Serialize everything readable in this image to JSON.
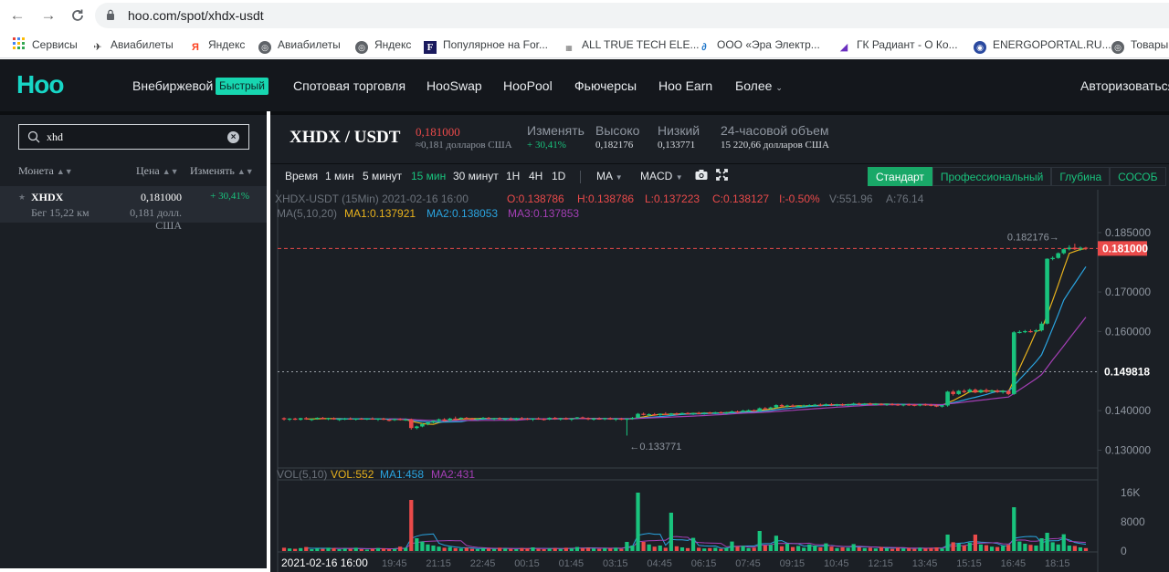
{
  "browser": {
    "url": "hoo.com/spot/xhdx-usdt",
    "bookmarks": [
      {
        "label": "Сервисы",
        "icon": "apps-grid-icon"
      },
      {
        "label": "Авиабилеты",
        "icon": "plane-icon"
      },
      {
        "label": "Яндекс",
        "icon": "yandex-icon"
      },
      {
        "label": "Авиабилеты",
        "icon": "globe-icon"
      },
      {
        "label": "Яндекс",
        "icon": "globe-icon"
      },
      {
        "label": "Популярное на For...",
        "icon": "forbes-icon"
      },
      {
        "label": "ALL TRUE TECH ELE...",
        "icon": "site-icon"
      },
      {
        "label": "ООО «Эра Электр...",
        "icon": "era-icon"
      },
      {
        "label": "ГК Радиант - О Ко...",
        "icon": "radiant-icon"
      },
      {
        "label": "ENERGOPORTAL.RU...",
        "icon": "energoportal-icon"
      },
      {
        "label": "Товары",
        "icon": "globe-icon"
      }
    ]
  },
  "header": {
    "logo": "Hoo",
    "nav": {
      "otc": "Внебиржевой",
      "otc_badge": "Быстрый",
      "spot": "Спотовая торговля",
      "swap": "HooSwap",
      "pool": "HooPool",
      "futures": "Фьючерсы",
      "earn": "Hoo Earn",
      "more": "Более",
      "login": "Авторизоваться"
    }
  },
  "market": {
    "search_value": "xhd",
    "columns": {
      "coin": "Монета",
      "price": "Цена",
      "change": "Изменять"
    },
    "rows": [
      {
        "symbol": "XHDX",
        "volume": "Бег 15,22 км",
        "price": "0,181000",
        "price_usd": "0,181 долл. США",
        "change": "+ 30,41%"
      }
    ]
  },
  "ticker": {
    "pair": "XHDX / USDT",
    "last_price": "0,181000",
    "last_price_usd": "≈0,181 долларов США",
    "change_label": "Изменять",
    "change_value": "+ 30,41%",
    "high_label": "Высоко",
    "high_value": "0,182176",
    "low_label": "Низкий",
    "low_value": "0,133771",
    "volume_label": "24-часовой объем",
    "volume_value": "15 220,66 долларов США"
  },
  "toolbar": {
    "time_label": "Время",
    "intervals": [
      "1 мин",
      "5 минут",
      "15 мин",
      "30 минут",
      "1H",
      "4H",
      "1D"
    ],
    "active_interval": "15 мин",
    "indicator1": "MA",
    "indicator2": "MACD",
    "views": [
      "Стандарт",
      "Профессиональный",
      "Глубина",
      "СОСОБ"
    ],
    "active_view": "Стандарт"
  },
  "chart_info": {
    "symbol_line": "XHDX-USDT (15Min) 2021-02-16 16:00",
    "o": "O:0.138786",
    "h": "H:0.138786",
    "l": "L:0.137223",
    "c": "C:0.138127",
    "i": "I:-0.50%",
    "v": "V:551.96",
    "a": "A:76.14",
    "ma_params": "MA(5,10,20)",
    "ma1": "MA1:0.137921",
    "ma2": "MA2:0.138053",
    "ma3": "MA3:0.137853",
    "vol_params": "VOL(5,10)",
    "vol": "VOL:552",
    "vol_ma1": "MA1:458",
    "vol_ma2": "MA2:431",
    "high_marker": "0.182176→",
    "low_marker": "←0.133771",
    "current_price_tag": "0.181000",
    "crosshair_price_tag": "0.149818",
    "first_time_label": "2021-02-16  16:00"
  },
  "colors": {
    "up": "#19c37d",
    "down": "#ea4a4a",
    "ma1": "#e8b21d",
    "ma2": "#2aa4e0",
    "ma3": "#a43fb5",
    "accent": "#17d6c6"
  },
  "chart_data": {
    "type": "candlestick",
    "price_axis_ticks": [
      0.185,
      0.17,
      0.16,
      0.14,
      0.13
    ],
    "price_axis_labels": [
      "0.185000",
      "0.170000",
      "0.160000",
      "0.140000",
      "0.130000"
    ],
    "price_range": [
      0.1255,
      0.188
    ],
    "volume_axis_labels": [
      "16K",
      "8000",
      "0"
    ],
    "volume_axis_ticks": [
      16000,
      8000,
      0
    ],
    "volume_max": 19000,
    "time_labels": [
      "19:45",
      "21:15",
      "22:45",
      "00:15",
      "01:45",
      "03:15",
      "04:45",
      "06:15",
      "07:45",
      "09:15",
      "10:45",
      "12:15",
      "13:45",
      "15:15",
      "16:45",
      "18:15"
    ],
    "high": 0.182176,
    "low": 0.133771,
    "last": 0.181,
    "crosshair": 0.149818,
    "candles": [
      [
        0.1381,
        0.1383,
        0.1375,
        0.1378,
        900
      ],
      [
        0.1378,
        0.1381,
        0.1374,
        0.138,
        700
      ],
      [
        0.138,
        0.1382,
        0.1376,
        0.1377,
        600
      ],
      [
        0.1377,
        0.1382,
        0.1375,
        0.1381,
        800
      ],
      [
        0.1381,
        0.1384,
        0.1377,
        0.1378,
        1100
      ],
      [
        0.1378,
        0.138,
        0.1374,
        0.1379,
        500
      ],
      [
        0.1379,
        0.1383,
        0.1377,
        0.1382,
        700
      ],
      [
        0.1382,
        0.1384,
        0.1378,
        0.1379,
        600
      ],
      [
        0.1379,
        0.1382,
        0.1376,
        0.1381,
        900
      ],
      [
        0.1381,
        0.1383,
        0.1377,
        0.1378,
        800
      ],
      [
        0.1378,
        0.138,
        0.1374,
        0.1379,
        500
      ],
      [
        0.1379,
        0.1382,
        0.1376,
        0.138,
        700
      ],
      [
        0.138,
        0.1383,
        0.1377,
        0.1378,
        600
      ],
      [
        0.1378,
        0.1381,
        0.1375,
        0.138,
        900
      ],
      [
        0.138,
        0.1382,
        0.1377,
        0.1379,
        500
      ],
      [
        0.1379,
        0.1381,
        0.1376,
        0.138,
        400
      ],
      [
        0.138,
        0.1383,
        0.1377,
        0.1378,
        600
      ],
      [
        0.1378,
        0.1381,
        0.1374,
        0.138,
        800
      ],
      [
        0.138,
        0.1382,
        0.1376,
        0.1377,
        700
      ],
      [
        0.1377,
        0.1379,
        0.1373,
        0.1376,
        500
      ],
      [
        0.1376,
        0.138,
        0.1374,
        0.1379,
        600
      ],
      [
        0.1379,
        0.1381,
        0.1375,
        0.1377,
        1200
      ],
      [
        0.1377,
        0.138,
        0.1374,
        0.1378,
        900
      ],
      [
        0.1378,
        0.138,
        0.1352,
        0.1356,
        14000
      ],
      [
        0.1356,
        0.1362,
        0.1353,
        0.136,
        3500
      ],
      [
        0.136,
        0.1368,
        0.1358,
        0.1366,
        2600
      ],
      [
        0.1366,
        0.1372,
        0.1363,
        0.137,
        1800
      ],
      [
        0.137,
        0.1376,
        0.1368,
        0.1374,
        1500
      ],
      [
        0.1374,
        0.138,
        0.1372,
        0.1378,
        1200
      ],
      [
        0.1378,
        0.1381,
        0.1372,
        0.1375,
        900
      ],
      [
        0.1375,
        0.1382,
        0.1373,
        0.138,
        1100
      ],
      [
        0.138,
        0.1385,
        0.1377,
        0.1379,
        800
      ],
      [
        0.1379,
        0.1383,
        0.1376,
        0.1382,
        700
      ],
      [
        0.1382,
        0.1384,
        0.1378,
        0.138,
        900
      ],
      [
        0.138,
        0.1382,
        0.1376,
        0.1378,
        600
      ],
      [
        0.1378,
        0.1381,
        0.1375,
        0.138,
        500
      ],
      [
        0.138,
        0.1384,
        0.1377,
        0.1382,
        800
      ],
      [
        0.1382,
        0.1384,
        0.1378,
        0.1379,
        700
      ],
      [
        0.1379,
        0.1382,
        0.1376,
        0.1381,
        600
      ],
      [
        0.1381,
        0.1383,
        0.1377,
        0.1378,
        900
      ],
      [
        0.1378,
        0.1381,
        0.1375,
        0.138,
        700
      ],
      [
        0.138,
        0.1383,
        0.1376,
        0.1377,
        600
      ],
      [
        0.1377,
        0.1382,
        0.1375,
        0.1381,
        500
      ],
      [
        0.1381,
        0.1384,
        0.1378,
        0.138,
        800
      ],
      [
        0.138,
        0.1382,
        0.1376,
        0.1378,
        700
      ],
      [
        0.1378,
        0.1381,
        0.1374,
        0.138,
        1000
      ],
      [
        0.138,
        0.1383,
        0.1377,
        0.1379,
        600
      ],
      [
        0.1379,
        0.1381,
        0.1375,
        0.1378,
        500
      ],
      [
        0.1378,
        0.1383,
        0.1376,
        0.1382,
        700
      ],
      [
        0.1382,
        0.1384,
        0.1377,
        0.1379,
        800
      ],
      [
        0.1379,
        0.1382,
        0.1375,
        0.1381,
        600
      ],
      [
        0.1381,
        0.1383,
        0.1377,
        0.1378,
        900
      ],
      [
        0.1378,
        0.1381,
        0.1374,
        0.138,
        700
      ],
      [
        0.138,
        0.1384,
        0.1378,
        0.1383,
        1100
      ],
      [
        0.1383,
        0.1385,
        0.1379,
        0.1381,
        800
      ],
      [
        0.1381,
        0.1383,
        0.1376,
        0.1378,
        900
      ],
      [
        0.1378,
        0.1382,
        0.1375,
        0.138,
        700
      ],
      [
        0.138,
        0.1383,
        0.1377,
        0.1379,
        600
      ],
      [
        0.1379,
        0.1382,
        0.1376,
        0.1381,
        800
      ],
      [
        0.1381,
        0.1383,
        0.1377,
        0.1378,
        700
      ],
      [
        0.1378,
        0.1381,
        0.1374,
        0.138,
        900
      ],
      [
        0.138,
        0.1382,
        0.1376,
        0.1377,
        600
      ],
      [
        0.1377,
        0.138,
        0.1337,
        0.138,
        2500
      ],
      [
        0.138,
        0.1384,
        0.1377,
        0.1382,
        1500
      ],
      [
        0.1382,
        0.1394,
        0.138,
        0.1392,
        16000
      ],
      [
        0.1392,
        0.1395,
        0.1388,
        0.139,
        2500
      ],
      [
        0.139,
        0.1393,
        0.1386,
        0.1391,
        1800
      ],
      [
        0.1391,
        0.1394,
        0.1387,
        0.1389,
        1200
      ],
      [
        0.1389,
        0.1393,
        0.1386,
        0.1392,
        1500
      ],
      [
        0.1392,
        0.1396,
        0.1389,
        0.139,
        900
      ],
      [
        0.139,
        0.1394,
        0.1387,
        0.1393,
        10500
      ],
      [
        0.1393,
        0.1395,
        0.1388,
        0.1391,
        1300
      ],
      [
        0.1391,
        0.1395,
        0.1389,
        0.1394,
        1000
      ],
      [
        0.1394,
        0.1396,
        0.139,
        0.1392,
        800
      ],
      [
        0.1392,
        0.1395,
        0.1389,
        0.1394,
        3600
      ],
      [
        0.1394,
        0.1397,
        0.1391,
        0.1393,
        900
      ],
      [
        0.1393,
        0.1396,
        0.139,
        0.1395,
        700
      ],
      [
        0.1395,
        0.1397,
        0.1392,
        0.1394,
        800
      ],
      [
        0.1394,
        0.1397,
        0.1391,
        0.1396,
        900
      ],
      [
        0.1396,
        0.1398,
        0.1392,
        0.1394,
        600
      ],
      [
        0.1394,
        0.1397,
        0.1391,
        0.1396,
        900
      ],
      [
        0.1396,
        0.14,
        0.1393,
        0.1398,
        2600
      ],
      [
        0.1398,
        0.14,
        0.1394,
        0.1397,
        1200
      ],
      [
        0.1397,
        0.1402,
        0.1395,
        0.14,
        1400
      ],
      [
        0.14,
        0.1403,
        0.1397,
        0.1401,
        800
      ],
      [
        0.1401,
        0.1403,
        0.1397,
        0.1399,
        900
      ],
      [
        0.1399,
        0.1408,
        0.1397,
        0.1406,
        5500
      ],
      [
        0.1406,
        0.1409,
        0.1403,
        0.1405,
        1500
      ],
      [
        0.1405,
        0.141,
        0.1403,
        0.1408,
        1700
      ],
      [
        0.1408,
        0.1416,
        0.1406,
        0.1414,
        4200
      ],
      [
        0.1414,
        0.1417,
        0.1409,
        0.1411,
        1300
      ],
      [
        0.1411,
        0.1415,
        0.1408,
        0.1413,
        2000
      ],
      [
        0.1413,
        0.1416,
        0.1409,
        0.141,
        1100
      ],
      [
        0.141,
        0.1414,
        0.1407,
        0.1412,
        1400
      ],
      [
        0.1412,
        0.1415,
        0.1409,
        0.1413,
        900
      ],
      [
        0.1413,
        0.1416,
        0.141,
        0.1414,
        1800
      ],
      [
        0.1414,
        0.1417,
        0.1411,
        0.1415,
        1500
      ],
      [
        0.1415,
        0.1418,
        0.1411,
        0.1413,
        1000
      ],
      [
        0.1413,
        0.1418,
        0.1411,
        0.1416,
        2100
      ],
      [
        0.1416,
        0.1419,
        0.1412,
        0.1414,
        1200
      ],
      [
        0.1414,
        0.1417,
        0.1411,
        0.1416,
        800
      ],
      [
        0.1416,
        0.1418,
        0.1412,
        0.1414,
        1000
      ],
      [
        0.1414,
        0.1417,
        0.1411,
        0.1416,
        900
      ],
      [
        0.1416,
        0.142,
        0.1413,
        0.1418,
        1900
      ],
      [
        0.1418,
        0.142,
        0.1414,
        0.1416,
        1000
      ],
      [
        0.1416,
        0.1419,
        0.1413,
        0.1418,
        800
      ],
      [
        0.1418,
        0.142,
        0.1414,
        0.1416,
        900
      ],
      [
        0.1416,
        0.1419,
        0.1413,
        0.1417,
        700
      ],
      [
        0.1417,
        0.1419,
        0.1413,
        0.1415,
        1100
      ],
      [
        0.1415,
        0.1418,
        0.1412,
        0.1417,
        800
      ],
      [
        0.1417,
        0.1419,
        0.1413,
        0.1416,
        600
      ],
      [
        0.1416,
        0.1418,
        0.1412,
        0.1414,
        900
      ],
      [
        0.1414,
        0.1417,
        0.1411,
        0.1416,
        700
      ],
      [
        0.1416,
        0.1418,
        0.1412,
        0.1415,
        800
      ],
      [
        0.1415,
        0.1417,
        0.1411,
        0.1414,
        600
      ],
      [
        0.1414,
        0.1417,
        0.1411,
        0.1416,
        900
      ],
      [
        0.1416,
        0.1418,
        0.1412,
        0.1415,
        700
      ],
      [
        0.1415,
        0.1417,
        0.1411,
        0.1413,
        800
      ],
      [
        0.1413,
        0.1416,
        0.1409,
        0.1411,
        1000
      ],
      [
        0.1411,
        0.1414,
        0.1408,
        0.1413,
        700
      ],
      [
        0.1413,
        0.145,
        0.141,
        0.1448,
        4500
      ],
      [
        0.1448,
        0.1452,
        0.1438,
        0.1442,
        2400
      ],
      [
        0.1442,
        0.1452,
        0.144,
        0.145,
        2000
      ],
      [
        0.145,
        0.1454,
        0.1444,
        0.1447,
        1500
      ],
      [
        0.1447,
        0.1456,
        0.1445,
        0.1453,
        2300
      ],
      [
        0.1453,
        0.1456,
        0.1444,
        0.1446,
        4500
      ],
      [
        0.1446,
        0.1454,
        0.1444,
        0.1452,
        1800
      ],
      [
        0.1452,
        0.1456,
        0.1445,
        0.1448,
        1600
      ],
      [
        0.1448,
        0.1453,
        0.1446,
        0.1451,
        1200
      ],
      [
        0.1451,
        0.1454,
        0.1445,
        0.1447,
        1100
      ],
      [
        0.1447,
        0.1452,
        0.1443,
        0.145,
        1400
      ],
      [
        0.145,
        0.1453,
        0.1439,
        0.1442,
        1700
      ],
      [
        0.1442,
        0.1601,
        0.144,
        0.1598,
        12000
      ],
      [
        0.1598,
        0.1603,
        0.1595,
        0.1599,
        2600
      ],
      [
        0.1599,
        0.1604,
        0.1596,
        0.1601,
        2000
      ],
      [
        0.1601,
        0.1605,
        0.1597,
        0.16,
        1700
      ],
      [
        0.16,
        0.1606,
        0.1598,
        0.1603,
        1500
      ],
      [
        0.1603,
        0.1625,
        0.16,
        0.162,
        3500
      ],
      [
        0.162,
        0.1785,
        0.1618,
        0.1784,
        5000
      ],
      [
        0.1784,
        0.179,
        0.178,
        0.1786,
        2400
      ],
      [
        0.1786,
        0.18,
        0.1784,
        0.1798,
        1800
      ],
      [
        0.1798,
        0.181,
        0.1795,
        0.1808,
        4600
      ],
      [
        0.1808,
        0.1818,
        0.1805,
        0.1812,
        1500
      ],
      [
        0.1812,
        0.1822,
        0.1806,
        0.1808,
        1400
      ],
      [
        0.1808,
        0.1815,
        0.1804,
        0.1812,
        1000
      ],
      [
        0.1812,
        0.1814,
        0.1806,
        0.181,
        800
      ]
    ]
  }
}
